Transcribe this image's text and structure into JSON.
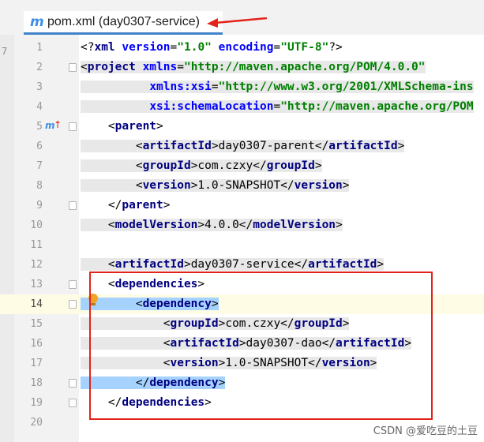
{
  "tab": {
    "icon": "maven-m-icon",
    "title": "pom.xml (day0307-service)"
  },
  "gutter_mark": "7",
  "override_marker": "m",
  "lines": [
    {
      "n": "1",
      "parts": [
        [
          "p",
          "<?"
        ],
        [
          "t",
          "xml"
        ],
        [
          "p",
          " "
        ],
        [
          "a",
          "version"
        ],
        [
          "p",
          "="
        ],
        [
          "v",
          "\"1.0\""
        ],
        [
          "p",
          " "
        ],
        [
          "a",
          "encoding"
        ],
        [
          "p",
          "="
        ],
        [
          "v",
          "\"UTF-8\""
        ],
        [
          "p",
          "?>"
        ]
      ]
    },
    {
      "n": "2",
      "parts": [
        [
          "p",
          "<"
        ],
        [
          "t",
          "project"
        ],
        [
          "p",
          " "
        ],
        [
          "a",
          "xmlns"
        ],
        [
          "p",
          "="
        ],
        [
          "v",
          "\"http://maven.apache.org/POM/4.0.0\""
        ]
      ]
    },
    {
      "n": "3",
      "parts": [
        [
          "p",
          "          "
        ],
        [
          "a",
          "xmlns:xsi"
        ],
        [
          "p",
          "="
        ],
        [
          "v",
          "\"http://www.w3.org/2001/XMLSchema-ins"
        ]
      ]
    },
    {
      "n": "4",
      "parts": [
        [
          "p",
          "          "
        ],
        [
          "a",
          "xsi:schemaLocation"
        ],
        [
          "p",
          "="
        ],
        [
          "v",
          "\"http://maven.apache.org/POM"
        ]
      ]
    },
    {
      "n": "5",
      "parts": [
        [
          "p",
          "    <"
        ],
        [
          "t",
          "parent"
        ],
        [
          "p",
          ">"
        ]
      ]
    },
    {
      "n": "6",
      "parts": [
        [
          "p",
          "        <"
        ],
        [
          "t",
          "artifactId"
        ],
        [
          "p",
          ">day0307-parent</"
        ],
        [
          "t",
          "artifactId"
        ],
        [
          "p",
          ">"
        ]
      ]
    },
    {
      "n": "7",
      "parts": [
        [
          "p",
          "        <"
        ],
        [
          "t",
          "groupId"
        ],
        [
          "p",
          ">com.czxy</"
        ],
        [
          "t",
          "groupId"
        ],
        [
          "p",
          ">"
        ]
      ]
    },
    {
      "n": "8",
      "parts": [
        [
          "p",
          "        <"
        ],
        [
          "t",
          "version"
        ],
        [
          "p",
          ">1.0-SNAPSHOT</"
        ],
        [
          "t",
          "version"
        ],
        [
          "p",
          ">"
        ]
      ]
    },
    {
      "n": "9",
      "parts": [
        [
          "p",
          "    </"
        ],
        [
          "t",
          "parent"
        ],
        [
          "p",
          ">"
        ]
      ]
    },
    {
      "n": "10",
      "parts": [
        [
          "p",
          "    <"
        ],
        [
          "t",
          "modelVersion"
        ],
        [
          "p",
          ">4.0.0</"
        ],
        [
          "t",
          "modelVersion"
        ],
        [
          "p",
          ">"
        ]
      ]
    },
    {
      "n": "11",
      "parts": []
    },
    {
      "n": "12",
      "parts": [
        [
          "p",
          "    <"
        ],
        [
          "t",
          "artifactId"
        ],
        [
          "p",
          ">day0307-service</"
        ],
        [
          "t",
          "artifactId"
        ],
        [
          "p",
          ">"
        ]
      ]
    },
    {
      "n": "13",
      "parts": [
        [
          "p",
          "    <"
        ],
        [
          "t",
          "dependencies"
        ],
        [
          "p",
          ">"
        ]
      ]
    },
    {
      "n": "14",
      "parts": [
        [
          "p",
          "        <"
        ],
        [
          "t",
          "dependency"
        ],
        [
          "p",
          ">"
        ]
      ]
    },
    {
      "n": "15",
      "parts": [
        [
          "p",
          "            <"
        ],
        [
          "t",
          "groupId"
        ],
        [
          "p",
          ">com.czxy</"
        ],
        [
          "t",
          "groupId"
        ],
        [
          "p",
          ">"
        ]
      ]
    },
    {
      "n": "16",
      "parts": [
        [
          "p",
          "            <"
        ],
        [
          "t",
          "artifactId"
        ],
        [
          "p",
          ">day0307-dao</"
        ],
        [
          "t",
          "artifactId"
        ],
        [
          "p",
          ">"
        ]
      ]
    },
    {
      "n": "17",
      "parts": [
        [
          "p",
          "            <"
        ],
        [
          "t",
          "version"
        ],
        [
          "p",
          ">1.0-SNAPSHOT</"
        ],
        [
          "t",
          "version"
        ],
        [
          "p",
          ">"
        ]
      ]
    },
    {
      "n": "18",
      "parts": [
        [
          "p",
          "        </"
        ],
        [
          "t",
          "dependency"
        ],
        [
          "p",
          ">"
        ]
      ]
    },
    {
      "n": "19",
      "parts": [
        [
          "p",
          "    </"
        ],
        [
          "t",
          "dependencies"
        ],
        [
          "p",
          ">"
        ]
      ]
    },
    {
      "n": "20",
      "parts": []
    }
  ],
  "watermark": "CSDN @爱吃豆的土豆",
  "colors": {
    "annotation": "#e2231a",
    "selection": "#a6d2ff",
    "current_line": "#fefce5",
    "tag": "#000080",
    "attr": "#0000ff",
    "value": "#008000"
  }
}
